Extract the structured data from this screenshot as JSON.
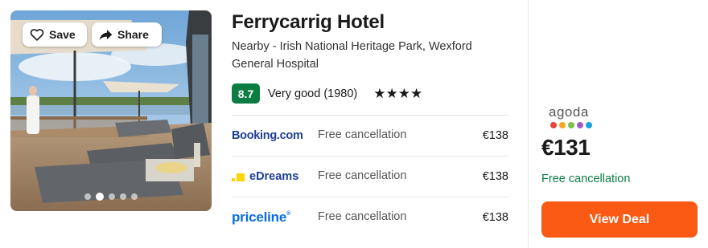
{
  "hotel": {
    "name": "Ferrycarrig Hotel",
    "nearby": "Nearby - Irish National Heritage Park, Wexford General Hospital",
    "score": "8.7",
    "rating_text": "Very good (1980)",
    "stars": "★★★★",
    "star_count": 4
  },
  "photo": {
    "save_label": "Save",
    "share_label": "Share",
    "icons": [
      "heart-icon",
      "share-arrow-icon"
    ],
    "carousel_dots": 5,
    "active_dot": 1
  },
  "offers": [
    {
      "provider": "Booking.com",
      "cancellation": "Free cancellation",
      "price": "€138"
    },
    {
      "provider": "eDreams",
      "cancellation": "Free cancellation",
      "price": "€138"
    },
    {
      "provider": "priceline",
      "provider_mark": "®",
      "cancellation": "Free cancellation",
      "price": "€138"
    }
  ],
  "deal": {
    "provider": "agoda",
    "price": "€131",
    "cancellation": "Free cancellation",
    "button_label": "View Deal"
  },
  "colors": {
    "score_badge": "#0b7d43",
    "free_cancellation": "#0b7d43",
    "view_deal_button": "#fa5a14",
    "booking_logo": "#1c3f94",
    "priceline_logo": "#0a6ce0",
    "edreams_mark": "#ffd400",
    "agoda_dots": [
      "#e7453a",
      "#f5a623",
      "#7bc043",
      "#a25bc4",
      "#1ba1e2"
    ]
  }
}
